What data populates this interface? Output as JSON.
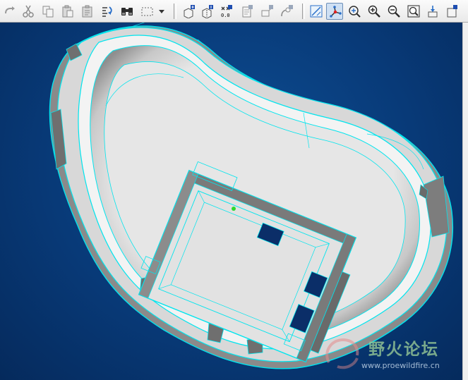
{
  "toolbar": {
    "buttons": [
      {
        "id": "redo",
        "icon": "redo-icon"
      },
      {
        "id": "cut",
        "icon": "scissors-icon"
      },
      {
        "id": "copy",
        "icon": "copy-icon"
      },
      {
        "id": "paste",
        "icon": "paste-icon"
      },
      {
        "id": "paste-special",
        "icon": "paste-special-icon"
      },
      {
        "id": "regenerate",
        "icon": "regenerate-icon"
      },
      {
        "id": "find",
        "icon": "binoculars-icon"
      },
      {
        "id": "select-box",
        "icon": "select-box-icon"
      },
      {
        "id": "datum-planes",
        "icon": "datum-plane-icon"
      },
      {
        "id": "datum-axes",
        "icon": "datum-axis-icon"
      },
      {
        "id": "datum-points",
        "icon": "datum-point-icon"
      },
      {
        "id": "datum-csys",
        "icon": "csys-icon"
      },
      {
        "id": "annotation",
        "icon": "annotation-icon"
      },
      {
        "id": "spin-center",
        "icon": "spin-center-icon"
      },
      {
        "id": "repaint",
        "icon": "repaint-icon"
      },
      {
        "id": "orient-mode",
        "icon": "orient-icon"
      },
      {
        "id": "saved-views",
        "icon": "saved-views-icon"
      },
      {
        "id": "zoom-in",
        "icon": "zoom-in-icon"
      },
      {
        "id": "zoom-out",
        "icon": "zoom-out-icon"
      },
      {
        "id": "refit",
        "icon": "refit-icon"
      },
      {
        "id": "reorient",
        "icon": "reorient-icon"
      },
      {
        "id": "more",
        "icon": "more-icon"
      }
    ],
    "datum_point_label": "0.0"
  },
  "watermark": {
    "title": "野火论坛",
    "url": "www.proewildfire.cn"
  },
  "colors": {
    "background": "#0a3a78",
    "model_face": "#e6e6e6",
    "wireframe": "#00e5ee",
    "side_wall": "#707070",
    "highlight": "#2dd92d"
  }
}
